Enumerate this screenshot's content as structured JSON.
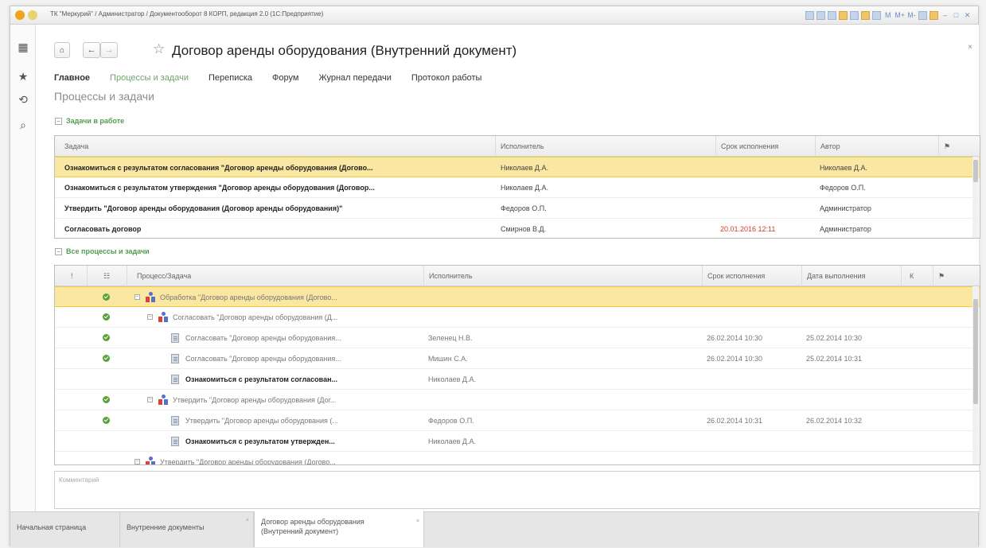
{
  "window": {
    "title": "ТК \"Меркурий\" / Администратор / Документооборот 8 КОРП, редакция 2.0 (1С:Предприятие)",
    "toolbar": [
      "M",
      "M+",
      "M-"
    ]
  },
  "document": {
    "title": "Договор аренды оборудования (Внутренний документ)",
    "close": "×"
  },
  "nav": {
    "home_icon": "home-icon",
    "back": "←",
    "forward": "→",
    "star": "☆"
  },
  "tabs": [
    "Главное",
    "Процессы и задачи",
    "Переписка",
    "Форум",
    "Журнал передачи",
    "Протокол работы"
  ],
  "section_title": "Процессы и задачи",
  "tasks_group": {
    "label": "Задачи в работе",
    "toggle": "−",
    "columns": [
      "Задача",
      "Исполнитель",
      "Срок исполнения",
      "Автор",
      "⚑"
    ],
    "rows": [
      {
        "task": "Ознакомиться с результатом согласования \"Договор аренды оборудования (Догово...",
        "executor": "Николаев Д.А.",
        "due": "",
        "author": "Николаев Д.А."
      },
      {
        "task": "Ознакомиться с результатом утверждения \"Договор аренды оборудования (Договор...",
        "executor": "Николаев Д.А.",
        "due": "",
        "author": "Федоров О.П."
      },
      {
        "task": "Утвердить \"Договор аренды оборудования (Договор аренды оборудования)\"",
        "executor": "Федоров О.П.",
        "due": "",
        "author": "Администратор"
      },
      {
        "task": "Согласовать договор",
        "executor": "Смирнов В.Д.",
        "due": "20.01.2016 12:11",
        "author": "Администратор"
      }
    ]
  },
  "processes_group": {
    "label": "Все процессы и задачи",
    "toggle": "−",
    "columns": [
      "!",
      "☷",
      "Процесс/Задача",
      "Исполнитель",
      "Срок исполнения",
      "Дата выполнения",
      "К",
      "⚑"
    ],
    "rows": [
      {
        "name": "Обработка \"Договор аренды оборудования (Догово...",
        "executor": "",
        "due": "",
        "done": "",
        "status": "done",
        "type": "process",
        "level": 0,
        "exp": "−",
        "bold": false
      },
      {
        "name": "Согласовать \"Договор аренды оборудования (Д...",
        "executor": "",
        "due": "",
        "done": "",
        "status": "done",
        "type": "process",
        "level": 1,
        "exp": "−",
        "bold": false
      },
      {
        "name": "Согласовать \"Договор аренды оборудования...",
        "executor": "Зеленец Н.В.",
        "due": "26.02.2014 10:30",
        "done": "25.02.2014 10:30",
        "status": "done",
        "type": "task",
        "level": 2,
        "exp": "",
        "bold": false
      },
      {
        "name": "Согласовать \"Договор аренды оборудования...",
        "executor": "Мишин С.А.",
        "due": "26.02.2014 10:30",
        "done": "25.02.2014 10:31",
        "status": "done",
        "type": "task",
        "level": 2,
        "exp": "",
        "bold": false
      },
      {
        "name": "Ознакомиться с результатом согласован...",
        "executor": "Николаев Д.А.",
        "due": "",
        "done": "",
        "status": "",
        "type": "task",
        "level": 2,
        "exp": "",
        "bold": true
      },
      {
        "name": "Утвердить \"Договор аренды оборудования (Дог...",
        "executor": "",
        "due": "",
        "done": "",
        "status": "done",
        "type": "process",
        "level": 1,
        "exp": "−",
        "bold": false
      },
      {
        "name": "Утвердить \"Договор аренды оборудования (...",
        "executor": "Федоров О.П.",
        "due": "26.02.2014 10:31",
        "done": "26.02.2014 10:32",
        "status": "done",
        "type": "task",
        "level": 2,
        "exp": "",
        "bold": false
      },
      {
        "name": "Ознакомиться с результатом утвержден...",
        "executor": "Николаев Д.А.",
        "due": "",
        "done": "",
        "status": "",
        "type": "task",
        "level": 2,
        "exp": "",
        "bold": true
      },
      {
        "name": "Утвердить \"Договор аренды оборудования (Догово...",
        "executor": "",
        "due": "",
        "done": "",
        "status": "",
        "type": "process",
        "level": 0,
        "exp": "−",
        "bold": false
      }
    ]
  },
  "comment_placeholder": "Комментарий",
  "bottom_tabs": [
    "Начальная страница",
    "Внутренние документы",
    "Договор аренды оборудования (Внутренний документ)"
  ],
  "colors": {
    "selection": "#fae7a1",
    "accent_green": "#4e9d4e",
    "overdue_red": "#d23a2e"
  }
}
